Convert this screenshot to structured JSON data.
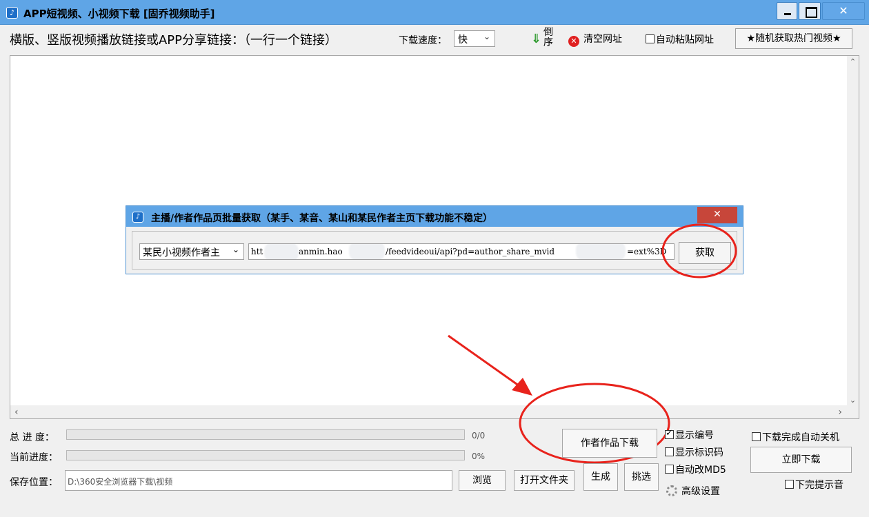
{
  "window": {
    "app_icon": "app-logo-icon",
    "title": "APP短视频、小视频下载 [固乔视频助手]",
    "close_glyph": "✕"
  },
  "toolbar": {
    "input_label": "横版、竖版视频播放链接或APP分享链接：（一行一个链接）",
    "speed_label": "下载速度：",
    "speed_value": "快",
    "reverse_label": "倒序",
    "clear_label": "清空网址",
    "autopaste_label": "自动粘贴网址",
    "random_label": "★随机获取热门视频★"
  },
  "url_area": {
    "value": ""
  },
  "dialog": {
    "title": "主播/作者作品页批量获取（某手、某音、某山和某民作者主页下载功能不稳定）",
    "close_glyph": "✕",
    "author_type": "某民小视频作者主",
    "url_fragments": [
      "htt",
      "anmin.hao",
      "/feedvideoui/api?pd=author_share_mvid",
      "=ext%3D"
    ],
    "get_label": "获取"
  },
  "progress": {
    "total_label": "总 进 度：",
    "total_value": "0/0",
    "total_fraction": 0,
    "current_label": "当前进度：",
    "current_value": "0%",
    "current_fraction": 0
  },
  "save": {
    "label": "保存位置：",
    "path": "D:\\360安全浏览器下载\\视频",
    "browse": "浏览",
    "open_folder": "打开文件夹"
  },
  "actions": {
    "author_download": "作者作品下载",
    "generate": "生成",
    "pick": "挑选",
    "show_number": "显示编号",
    "show_id": "显示标识码",
    "auto_md5": "自动改MD5",
    "advanced": "高级设置",
    "shutdown": "下载完成自动关机",
    "download_now": "立即下载",
    "done_sound": "下完提示音"
  },
  "colors": {
    "annotation": "#e8231c",
    "titlebar": "#5fa5e6",
    "dialog_close": "#c7463a"
  }
}
